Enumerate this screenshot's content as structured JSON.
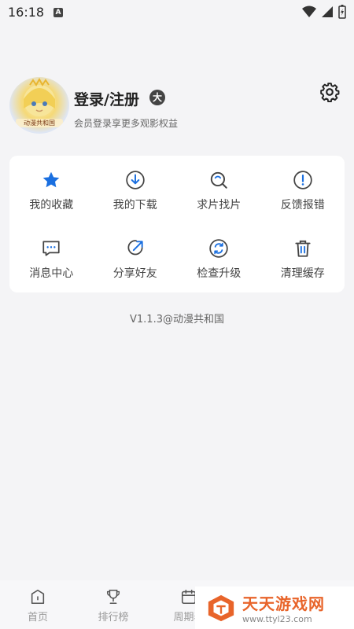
{
  "status": {
    "time": "16:18",
    "notif_letter": "A"
  },
  "profile": {
    "avatar_caption": "动漫共和国",
    "login_title": "登录/注册",
    "badge_text": "大",
    "subtitle": "会员登录享更多观影权益"
  },
  "menu": {
    "items": [
      {
        "label": "我的收藏",
        "icon": "star-icon"
      },
      {
        "label": "我的下载",
        "icon": "download-icon"
      },
      {
        "label": "求片找片",
        "icon": "search-icon"
      },
      {
        "label": "反馈报错",
        "icon": "feedback-icon"
      },
      {
        "label": "消息中心",
        "icon": "message-icon"
      },
      {
        "label": "分享好友",
        "icon": "share-icon"
      },
      {
        "label": "检查升级",
        "icon": "refresh-icon"
      },
      {
        "label": "清理缓存",
        "icon": "trash-icon"
      }
    ]
  },
  "version": "V1.1.3@动漫共和国",
  "nav": {
    "items": [
      {
        "label": "首页",
        "icon": "home-icon"
      },
      {
        "label": "排行榜",
        "icon": "trophy-icon"
      },
      {
        "label": "周期表",
        "icon": "calendar-icon"
      }
    ]
  },
  "watermark": {
    "title": "天天游戏网",
    "url": "www.ttyl23.com"
  },
  "colors": {
    "accent": "#1a6fe0",
    "icon_gray": "#444444",
    "watermark_orange": "#e8642a"
  }
}
